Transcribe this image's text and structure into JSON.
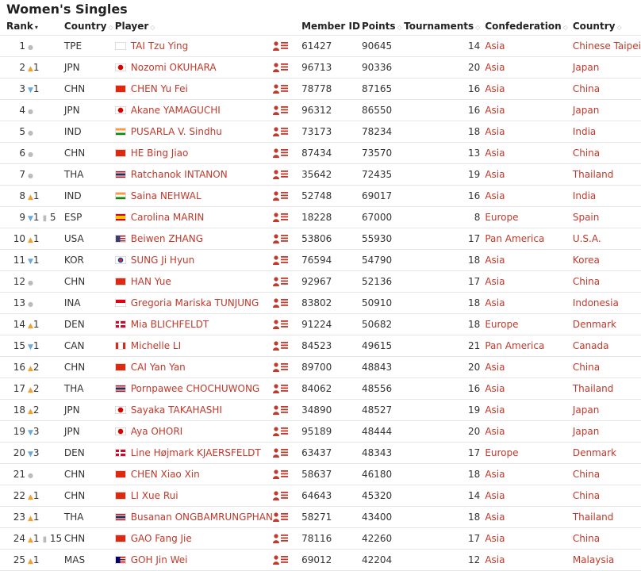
{
  "title": "Women's Singles",
  "columns": {
    "rank": "Rank",
    "country": "Country",
    "player": "Player",
    "member_id": "Member ID",
    "points": "Points",
    "tournaments": "Tournaments",
    "confederation": "Confederation",
    "country_full": "Country"
  },
  "accent": "#c0392b",
  "rows": [
    {
      "rank": "1",
      "move": "none",
      "delta": "",
      "extra": "",
      "code": "TPE",
      "player": "TAI Tzu Ying",
      "member_id": "61427",
      "points": "90645",
      "tournaments": "14",
      "confed": "Asia",
      "country": "Chinese Taipei"
    },
    {
      "rank": "2",
      "move": "up",
      "delta": "1",
      "extra": "",
      "code": "JPN",
      "player": "Nozomi OKUHARA",
      "member_id": "96713",
      "points": "90336",
      "tournaments": "20",
      "confed": "Asia",
      "country": "Japan"
    },
    {
      "rank": "3",
      "move": "down",
      "delta": "1",
      "extra": "",
      "code": "CHN",
      "player": "CHEN Yu Fei",
      "member_id": "78778",
      "points": "87165",
      "tournaments": "16",
      "confed": "Asia",
      "country": "China"
    },
    {
      "rank": "4",
      "move": "none",
      "delta": "",
      "extra": "",
      "code": "JPN",
      "player": "Akane YAMAGUCHI",
      "member_id": "96312",
      "points": "86550",
      "tournaments": "16",
      "confed": "Asia",
      "country": "Japan"
    },
    {
      "rank": "5",
      "move": "none",
      "delta": "",
      "extra": "",
      "code": "IND",
      "player": "PUSARLA V. Sindhu",
      "member_id": "73173",
      "points": "78234",
      "tournaments": "18",
      "confed": "Asia",
      "country": "India"
    },
    {
      "rank": "6",
      "move": "none",
      "delta": "",
      "extra": "",
      "code": "CHN",
      "player": "HE Bing Jiao",
      "member_id": "87434",
      "points": "73570",
      "tournaments": "13",
      "confed": "Asia",
      "country": "China"
    },
    {
      "rank": "7",
      "move": "none",
      "delta": "",
      "extra": "",
      "code": "THA",
      "player": "Ratchanok INTANON",
      "member_id": "35642",
      "points": "72435",
      "tournaments": "19",
      "confed": "Asia",
      "country": "Thailand"
    },
    {
      "rank": "8",
      "move": "up",
      "delta": "1",
      "extra": "",
      "code": "IND",
      "player": "Saina NEHWAL",
      "member_id": "52748",
      "points": "69017",
      "tournaments": "16",
      "confed": "Asia",
      "country": "India"
    },
    {
      "rank": "9",
      "move": "down",
      "delta": "1",
      "extra": "5",
      "code": "ESP",
      "player": "Carolina MARIN",
      "member_id": "18228",
      "points": "67000",
      "tournaments": "8",
      "confed": "Europe",
      "country": "Spain"
    },
    {
      "rank": "10",
      "move": "up",
      "delta": "1",
      "extra": "",
      "code": "USA",
      "player": "Beiwen ZHANG",
      "member_id": "53806",
      "points": "55930",
      "tournaments": "17",
      "confed": "Pan America",
      "country": "U.S.A."
    },
    {
      "rank": "11",
      "move": "down",
      "delta": "1",
      "extra": "",
      "code": "KOR",
      "player": "SUNG Ji Hyun",
      "member_id": "76594",
      "points": "54790",
      "tournaments": "18",
      "confed": "Asia",
      "country": "Korea"
    },
    {
      "rank": "12",
      "move": "none",
      "delta": "",
      "extra": "",
      "code": "CHN",
      "player": "HAN Yue",
      "member_id": "92967",
      "points": "52136",
      "tournaments": "17",
      "confed": "Asia",
      "country": "China"
    },
    {
      "rank": "13",
      "move": "none",
      "delta": "",
      "extra": "",
      "code": "INA",
      "player": "Gregoria Mariska TUNJUNG",
      "member_id": "83802",
      "points": "50910",
      "tournaments": "18",
      "confed": "Asia",
      "country": "Indonesia"
    },
    {
      "rank": "14",
      "move": "up",
      "delta": "1",
      "extra": "",
      "code": "DEN",
      "player": "Mia BLICHFELDT",
      "member_id": "91224",
      "points": "50682",
      "tournaments": "18",
      "confed": "Europe",
      "country": "Denmark"
    },
    {
      "rank": "15",
      "move": "down",
      "delta": "1",
      "extra": "",
      "code": "CAN",
      "player": "Michelle LI",
      "member_id": "84523",
      "points": "49615",
      "tournaments": "21",
      "confed": "Pan America",
      "country": "Canada"
    },
    {
      "rank": "16",
      "move": "up",
      "delta": "2",
      "extra": "",
      "code": "CHN",
      "player": "CAI Yan Yan",
      "member_id": "89700",
      "points": "48843",
      "tournaments": "20",
      "confed": "Asia",
      "country": "China"
    },
    {
      "rank": "17",
      "move": "up",
      "delta": "2",
      "extra": "",
      "code": "THA",
      "player": "Pornpawee CHOCHUWONG",
      "member_id": "84062",
      "points": "48556",
      "tournaments": "16",
      "confed": "Asia",
      "country": "Thailand"
    },
    {
      "rank": "18",
      "move": "up",
      "delta": "2",
      "extra": "",
      "code": "JPN",
      "player": "Sayaka TAKAHASHI",
      "member_id": "34890",
      "points": "48527",
      "tournaments": "19",
      "confed": "Asia",
      "country": "Japan"
    },
    {
      "rank": "19",
      "move": "down",
      "delta": "3",
      "extra": "",
      "code": "JPN",
      "player": "Aya OHORI",
      "member_id": "95189",
      "points": "48444",
      "tournaments": "20",
      "confed": "Asia",
      "country": "Japan"
    },
    {
      "rank": "20",
      "move": "down",
      "delta": "3",
      "extra": "",
      "code": "DEN",
      "player": "Line Højmark KJAERSFELDT",
      "member_id": "63437",
      "points": "48343",
      "tournaments": "17",
      "confed": "Europe",
      "country": "Denmark"
    },
    {
      "rank": "21",
      "move": "none",
      "delta": "",
      "extra": "",
      "code": "CHN",
      "player": "CHEN Xiao Xin",
      "member_id": "58637",
      "points": "46180",
      "tournaments": "18",
      "confed": "Asia",
      "country": "China"
    },
    {
      "rank": "22",
      "move": "up",
      "delta": "1",
      "extra": "",
      "code": "CHN",
      "player": "LI Xue Rui",
      "member_id": "64643",
      "points": "45320",
      "tournaments": "14",
      "confed": "Asia",
      "country": "China"
    },
    {
      "rank": "23",
      "move": "up",
      "delta": "1",
      "extra": "",
      "code": "THA",
      "player": "Busanan ONGBAMRUNGPHAN",
      "member_id": "58271",
      "points": "43400",
      "tournaments": "18",
      "confed": "Asia",
      "country": "Thailand"
    },
    {
      "rank": "24",
      "move": "up",
      "delta": "1",
      "extra": "15",
      "code": "CHN",
      "player": "GAO Fang Jie",
      "member_id": "78116",
      "points": "42260",
      "tournaments": "17",
      "confed": "Asia",
      "country": "China"
    },
    {
      "rank": "25",
      "move": "up",
      "delta": "1",
      "extra": "",
      "code": "MAS",
      "player": "GOH Jin Wei",
      "member_id": "69012",
      "points": "42204",
      "tournaments": "12",
      "confed": "Asia",
      "country": "Malaysia"
    }
  ]
}
